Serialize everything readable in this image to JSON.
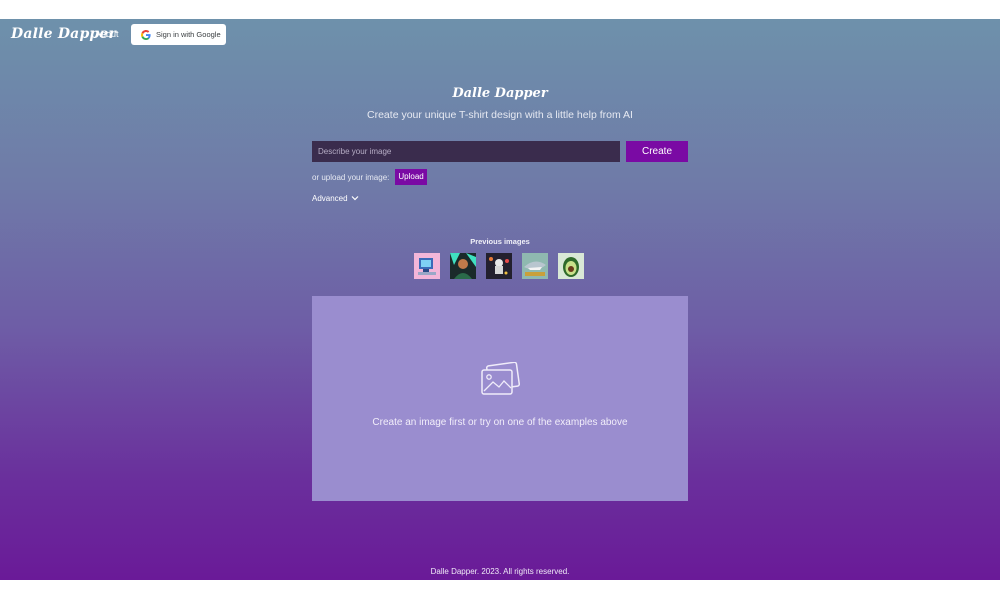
{
  "nav": {
    "brand": "Dalle Dapper",
    "about": "About",
    "google_signin": "Sign in with Google"
  },
  "hero": {
    "title": "Dalle Dapper",
    "subtitle": "Create your unique T-shirt design with a little help from AI"
  },
  "prompt": {
    "placeholder": "Describe your image",
    "value": "",
    "create_label": "Create"
  },
  "upload": {
    "label": "or upload your image:",
    "button": "Upload"
  },
  "advanced": {
    "label": "Advanced"
  },
  "previous": {
    "title": "Previous images",
    "items": [
      "computer-thumbnail",
      "portrait-thumbnail",
      "astronaut-thumbnail",
      "shark-thumbnail",
      "avocado-thumbnail"
    ]
  },
  "preview": {
    "icon": "image-placeholder-icon",
    "message": "Create an image first or try on one of the examples above"
  },
  "footer": {
    "text": "Dalle Dapper. 2023. All rights reserved."
  },
  "colors": {
    "accent": "#7a0aa4",
    "input_bg": "#3a2c4d",
    "preview_bg": "#9a8dcf"
  }
}
